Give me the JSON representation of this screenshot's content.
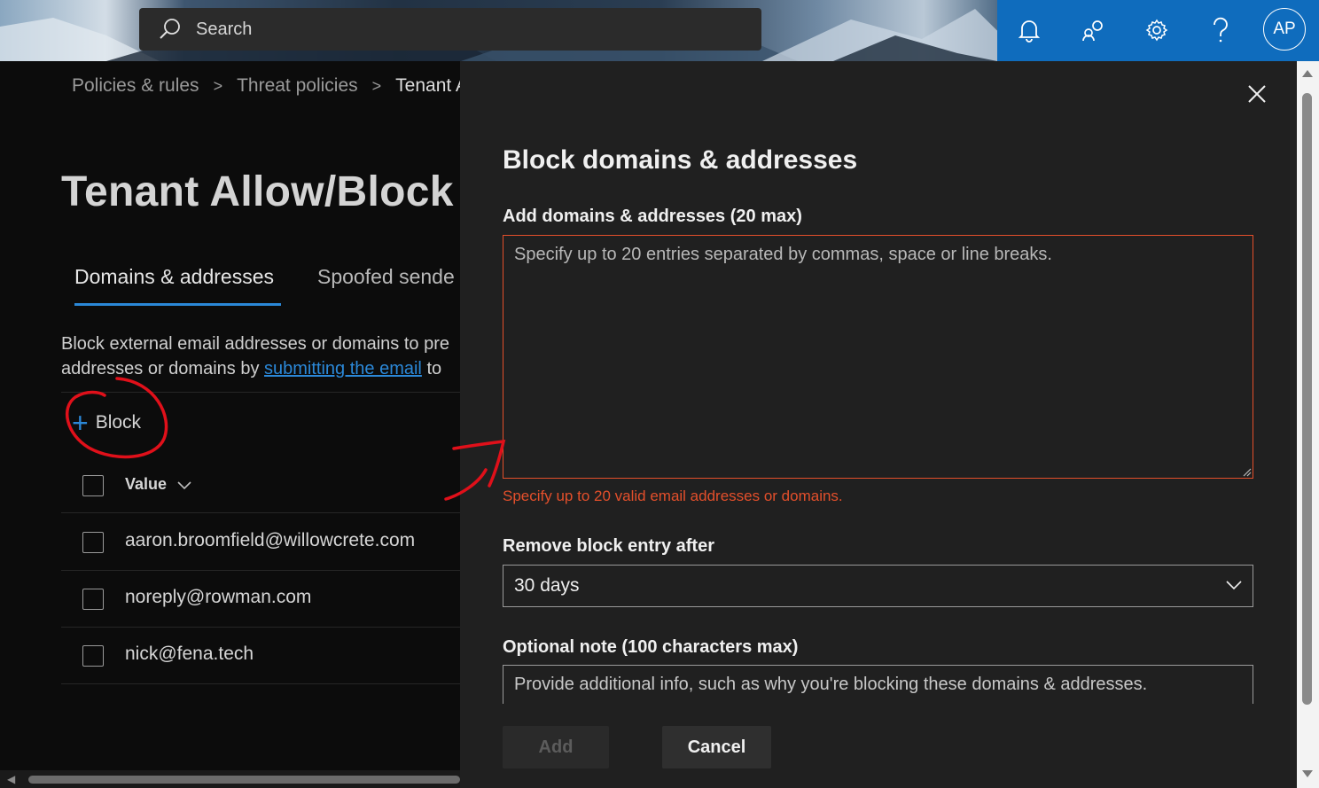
{
  "header": {
    "search_placeholder": "Search",
    "avatar_initials": "AP",
    "icons": [
      "bell-icon",
      "community-icon",
      "gear-icon",
      "help-icon"
    ],
    "accent_color": "#0f6cbd"
  },
  "breadcrumb": {
    "items": [
      "Policies & rules",
      "Threat policies",
      "Tenant Al"
    ]
  },
  "page": {
    "title": "Tenant Allow/Block",
    "tabs": [
      "Domains & addresses",
      "Spoofed sende"
    ],
    "description_line1": "Block external email addresses or domains to pre",
    "description_line2_before": "addresses or domains by ",
    "description_link": "submitting the email",
    "description_line2_after": " to",
    "block_button": "Block",
    "column_value": "Value",
    "rows": [
      "aaron.broomfield@willowcrete.com",
      "noreply@rowman.com",
      "nick@fena.tech"
    ]
  },
  "panel": {
    "title": "Block domains & addresses",
    "entries_label": "Add domains & addresses (20 max)",
    "entries_placeholder": "Specify up to 20 entries separated by commas, space or line breaks.",
    "entries_error": "Specify up to 20 valid email addresses or domains.",
    "remove_label": "Remove block entry after",
    "remove_value": "30 days",
    "note_label": "Optional note (100 characters max)",
    "note_placeholder": "Provide additional info, such as why you're blocking these domains & addresses.",
    "add_button": "Add",
    "cancel_button": "Cancel",
    "error_color": "#e34f2b"
  }
}
